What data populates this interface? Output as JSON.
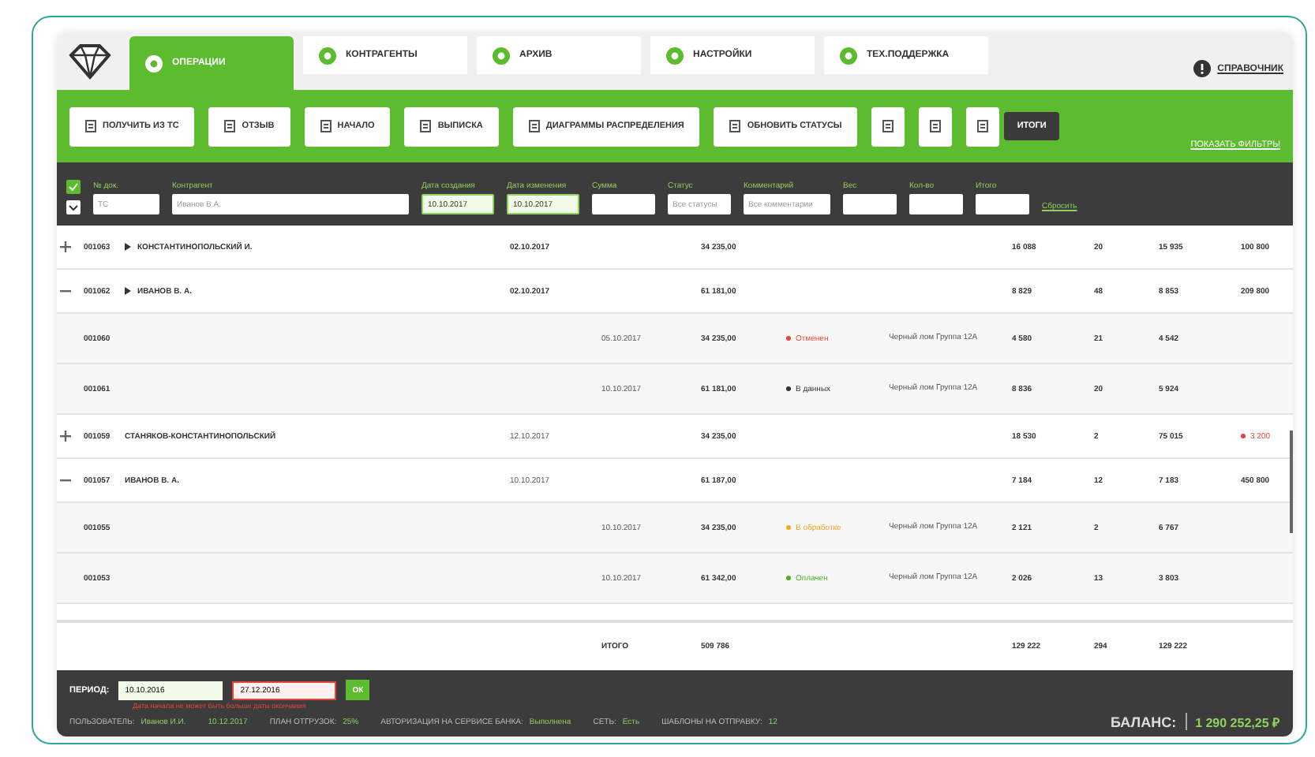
{
  "tabs": [
    {
      "label": "ОПЕРАЦИИ",
      "selected": true
    },
    {
      "label": "КОНТРАГЕНТЫ",
      "selected": false
    },
    {
      "label": "АРХИВ",
      "selected": false
    },
    {
      "label": "НАСТРОЙКИ",
      "selected": false
    },
    {
      "label": "ТЕХ.ПОДДЕРЖКА",
      "selected": false
    }
  ],
  "help_link": "СПРАВОЧНИК",
  "toolbar": {
    "buttons": [
      {
        "kind": "text",
        "label": "ПОЛУЧИТЬ ИЗ ТС"
      },
      {
        "kind": "text",
        "label": "ОТЗЫВ"
      },
      {
        "kind": "text",
        "label": "НАЧАЛО"
      },
      {
        "kind": "text",
        "label": "ВЫПИСКА"
      },
      {
        "kind": "text",
        "label": "ДИАГРАММЫ РАСПРЕДЕЛЕНИЯ"
      },
      {
        "kind": "text",
        "label": "ОБНОВИТЬ СТАТУСЫ"
      },
      {
        "kind": "icon"
      },
      {
        "kind": "icon"
      },
      {
        "kind": "icon"
      }
    ],
    "tooltip": "ИТОГИ",
    "filters_link": "ПОКАЗАТЬ ФИЛЬТРЫ"
  },
  "filters": {
    "fields": [
      {
        "label": "№ док.",
        "placeholder": "ТС"
      },
      {
        "label": "Контрагент",
        "placeholder": "Иванов В.А."
      },
      {
        "label": "Дата создания",
        "value": "10.10.2017"
      },
      {
        "label": "Дата изменения",
        "value": "10.10.2017"
      },
      {
        "label": "Сумма"
      },
      {
        "label": "Статус",
        "placeholder": "Все статусы"
      },
      {
        "label": "Комментарий",
        "placeholder": "Все комментарии"
      },
      {
        "label": "Вес"
      },
      {
        "label": "Кол-во"
      },
      {
        "label": "Итого"
      }
    ],
    "reset": "Сбросить"
  },
  "rows": [
    {
      "kind": "group",
      "expanded": false,
      "flagged": true,
      "number": "001063",
      "name": "КОНСТАНТИНОПОЛЬСКИЙ И.",
      "date_created": "02.10.2017",
      "amount": "34 235,00",
      "weight": "16 088",
      "count": "20",
      "net": "15 935",
      "cost": "100 800",
      "cost_alert": false
    },
    {
      "kind": "group",
      "expanded": true,
      "flagged": true,
      "number": "001062",
      "name": "ИВАНОВ В. А.",
      "date_created": "02.10.2017",
      "amount": "61 181,00",
      "weight": "8 829",
      "count": "48",
      "net": "8 853",
      "cost": "209 800",
      "cost_alert": false
    },
    {
      "kind": "item",
      "number": "001060",
      "date_changed": "05.10.2017",
      "amount": "34 235,00",
      "status": {
        "text": "Отменен",
        "color": "#e8443a"
      },
      "comment": "Черный лом Группа 12А",
      "weight": "4 580",
      "count": "21",
      "net": "4 542"
    },
    {
      "kind": "item",
      "number": "001061",
      "date_changed": "10.10.2017",
      "amount": "61 181,00",
      "status": {
        "text": "В данных",
        "color": "#333333"
      },
      "comment": "Черный лом Группа 12А",
      "weight": "8 836",
      "count": "20",
      "net": "5 924"
    },
    {
      "kind": "group",
      "expanded": false,
      "flagged": false,
      "number": "001059",
      "name": "СТАНЯКОВ-КОНСТАНТИНОПОЛЬСКИЙ",
      "date_created": "12.10.2017",
      "amount": "34 235,00",
      "weight": "18 530",
      "count": "2",
      "net": "75 015",
      "cost": "3 200",
      "cost_alert": true
    },
    {
      "kind": "group",
      "expanded": true,
      "flagged": false,
      "number": "001057",
      "name": "ИВАНОВ В. А.",
      "date_created": "10.10.2017",
      "amount": "61 187,00",
      "weight": "7 184",
      "count": "12",
      "net": "7 183",
      "cost": "450 800",
      "cost_alert": false
    },
    {
      "kind": "item",
      "number": "001055",
      "date_changed": "10.10.2017",
      "amount": "34 235,00",
      "status": {
        "text": "В обработке",
        "color": "#f5a623"
      },
      "comment": "Черный лом Группа 12А",
      "weight": "2 121",
      "count": "2",
      "net": "6 767"
    },
    {
      "kind": "item",
      "number": "001053",
      "date_changed": "10.10.2017",
      "amount": "61 342,00",
      "status": {
        "text": "Оплачен",
        "color": "#4caf2a"
      },
      "comment": "Черный лом Группа 12А",
      "weight": "2 026",
      "count": "13",
      "net": "3 803"
    }
  ],
  "totals": {
    "label": "ИТОГО",
    "amount": "509 786",
    "weight": "129 222",
    "count": "294",
    "net": "129 222"
  },
  "period": {
    "label": "ПЕРИОД:",
    "from": "10.10.2016",
    "to": "27.12.2016",
    "button": "ОК",
    "error": "Дата начала не может быть больше даты окончания"
  },
  "status_bar": [
    {
      "label": "ПОЛЬЗОВАТЕЛЬ:",
      "value": "Иванов И.И."
    },
    {
      "value": "10.12.2017"
    },
    {
      "label": "ПЛАН ОТГРУЗОК:",
      "value": "25%"
    },
    {
      "label": "АВТОРИЗАЦИЯ НА СЕРВИСЕ БАНКА:",
      "value": "Выполнена"
    },
    {
      "label": "СЕТЬ:",
      "value": "Есть"
    },
    {
      "label": "ШАБЛОНЫ НА ОТПРАВКУ:",
      "value": "12"
    }
  ],
  "balance": {
    "label": "БАЛАНС:",
    "value": "1 290 252,25 ₽"
  }
}
